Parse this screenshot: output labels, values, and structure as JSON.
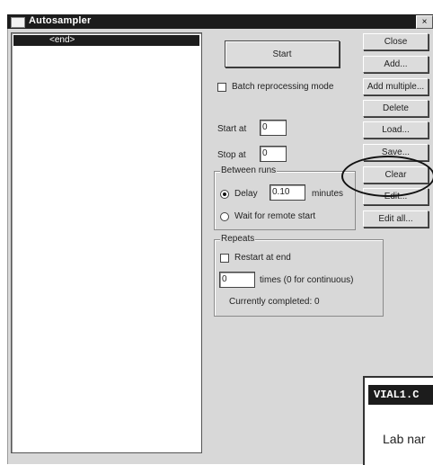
{
  "window": {
    "title": "Autosampler",
    "close_glyph": "×"
  },
  "list": {
    "selected_item": "<end>"
  },
  "controls": {
    "start_label": "Start",
    "batch_label": "Batch reprocessing mode",
    "batch_checked": false,
    "start_at_label": "Start at",
    "start_at_value": "0",
    "stop_at_label": "Stop at",
    "stop_at_value": "0"
  },
  "between_runs": {
    "title": "Between runs",
    "delay_label": "Delay",
    "delay_value": "0.10",
    "minutes_label": "minutes",
    "wait_label": "Wait for remote start",
    "selected": "delay"
  },
  "repeats": {
    "title": "Repeats",
    "restart_label": "Restart at end",
    "restart_checked": false,
    "times_value": "0",
    "times_label": "times (0 for continuous)",
    "completed_label": "Currently completed: 0"
  },
  "buttons": {
    "close": "Close",
    "add": "Add...",
    "add_multiple": "Add multiple...",
    "delete": "Delete",
    "load": "Load...",
    "save": "Save...",
    "clear": "Clear",
    "edit": "Edit...",
    "edit_all": "Edit all..."
  },
  "vial_panel": {
    "header": "VIAL1.C",
    "text": "Lab nar"
  }
}
